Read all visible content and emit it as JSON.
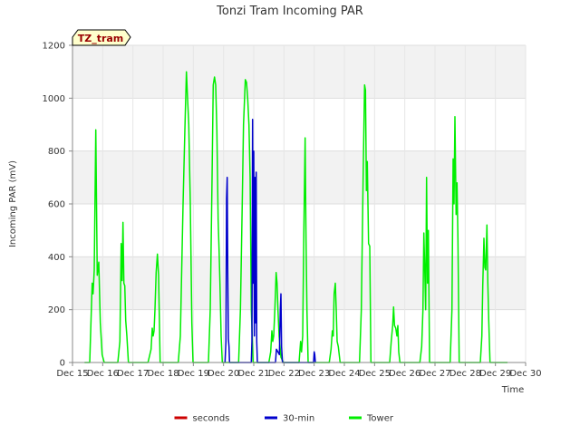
{
  "chart_data": {
    "type": "line",
    "title": "Tonzi Tram Incoming PAR",
    "xlabel": "Time",
    "ylabel": "Incoming PAR (mV)",
    "badge": {
      "text": "TZ_tram",
      "bg": "#ffffcc",
      "fg": "#990000"
    },
    "ylim": [
      0,
      1200
    ],
    "yticks": [
      0,
      200,
      400,
      600,
      800,
      1000,
      1200
    ],
    "xlim": [
      15,
      30
    ],
    "xticks": [
      15,
      16,
      17,
      18,
      19,
      20,
      21,
      22,
      23,
      24,
      25,
      26,
      27,
      28,
      29,
      30
    ],
    "xtick_labels": [
      "Dec 15",
      "Dec 16",
      "Dec 17",
      "Dec 18",
      "Dec 19",
      "Dec 20",
      "Dec 21",
      "Dec 22",
      "Dec 23",
      "Dec 24",
      "Dec 25",
      "Dec 26",
      "Dec 27",
      "Dec 28",
      "Dec 29",
      "Dec 30"
    ],
    "grid": true,
    "legend_position": "bottom",
    "series": [
      {
        "name": "seconds",
        "color": "#cc0000",
        "points": []
      },
      {
        "name": "30-min",
        "color": "#0000cc",
        "points": [
          [
            20.05,
            0
          ],
          [
            20.08,
            80
          ],
          [
            20.1,
            620
          ],
          [
            20.12,
            700
          ],
          [
            20.14,
            350
          ],
          [
            20.16,
            90
          ],
          [
            20.18,
            60
          ],
          [
            20.2,
            0
          ],
          [
            20.92,
            0
          ],
          [
            20.94,
            80
          ],
          [
            20.96,
            920
          ],
          [
            20.98,
            300
          ],
          [
            21.0,
            800
          ],
          [
            21.02,
            100
          ],
          [
            21.04,
            700
          ],
          [
            21.06,
            150
          ],
          [
            21.08,
            720
          ],
          [
            21.1,
            80
          ],
          [
            21.12,
            0
          ],
          [
            21.72,
            0
          ],
          [
            21.75,
            50
          ],
          [
            21.8,
            40
          ],
          [
            21.85,
            30
          ],
          [
            21.88,
            200
          ],
          [
            21.9,
            260
          ],
          [
            21.92,
            60
          ],
          [
            21.95,
            0
          ],
          [
            22.98,
            0
          ],
          [
            23.0,
            40
          ],
          [
            23.02,
            30
          ],
          [
            23.04,
            0
          ]
        ]
      },
      {
        "name": "Tower",
        "color": "#00ee00",
        "points": [
          [
            15.4,
            0
          ],
          [
            15.57,
            0
          ],
          [
            15.65,
            300
          ],
          [
            15.68,
            260
          ],
          [
            15.72,
            350
          ],
          [
            15.77,
            880
          ],
          [
            15.82,
            330
          ],
          [
            15.87,
            380
          ],
          [
            15.92,
            150
          ],
          [
            15.98,
            30
          ],
          [
            16.05,
            0
          ],
          [
            16.1,
            0
          ],
          [
            16.5,
            0
          ],
          [
            16.57,
            80
          ],
          [
            16.61,
            450
          ],
          [
            16.64,
            310
          ],
          [
            16.67,
            530
          ],
          [
            16.7,
            300
          ],
          [
            16.73,
            290
          ],
          [
            16.76,
            160
          ],
          [
            16.8,
            100
          ],
          [
            16.85,
            0
          ],
          [
            16.9,
            0
          ],
          [
            17.5,
            0
          ],
          [
            17.6,
            50
          ],
          [
            17.64,
            130
          ],
          [
            17.67,
            100
          ],
          [
            17.7,
            120
          ],
          [
            17.73,
            200
          ],
          [
            17.77,
            340
          ],
          [
            17.81,
            410
          ],
          [
            17.85,
            330
          ],
          [
            17.9,
            0
          ],
          [
            17.95,
            0
          ],
          [
            18.5,
            0
          ],
          [
            18.57,
            100
          ],
          [
            18.66,
            600
          ],
          [
            18.72,
            880
          ],
          [
            18.77,
            1100
          ],
          [
            18.8,
            1020
          ],
          [
            18.85,
            900
          ],
          [
            18.9,
            600
          ],
          [
            18.95,
            150
          ],
          [
            18.99,
            0
          ],
          [
            19.1,
            0
          ],
          [
            19.5,
            0
          ],
          [
            19.56,
            200
          ],
          [
            19.62,
            700
          ],
          [
            19.66,
            1050
          ],
          [
            19.7,
            1080
          ],
          [
            19.74,
            1050
          ],
          [
            19.78,
            880
          ],
          [
            19.82,
            540
          ],
          [
            19.85,
            430
          ],
          [
            19.88,
            300
          ],
          [
            19.92,
            100
          ],
          [
            19.96,
            0
          ],
          [
            20.15,
            0
          ],
          [
            20.5,
            0
          ],
          [
            20.56,
            200
          ],
          [
            20.62,
            600
          ],
          [
            20.66,
            900
          ],
          [
            20.72,
            1070
          ],
          [
            20.76,
            1060
          ],
          [
            20.8,
            1000
          ],
          [
            20.84,
            900
          ],
          [
            20.88,
            700
          ],
          [
            20.92,
            200
          ],
          [
            20.98,
            0
          ],
          [
            21.1,
            0
          ],
          [
            21.5,
            0
          ],
          [
            21.56,
            40
          ],
          [
            21.6,
            120
          ],
          [
            21.63,
            80
          ],
          [
            21.66,
            100
          ],
          [
            21.7,
            200
          ],
          [
            21.74,
            340
          ],
          [
            21.77,
            300
          ],
          [
            21.8,
            200
          ],
          [
            21.84,
            100
          ],
          [
            21.9,
            20
          ],
          [
            21.98,
            0
          ],
          [
            22.1,
            0
          ],
          [
            22.5,
            0
          ],
          [
            22.55,
            80
          ],
          [
            22.58,
            40
          ],
          [
            22.62,
            100
          ],
          [
            22.66,
            500
          ],
          [
            22.7,
            850
          ],
          [
            22.73,
            460
          ],
          [
            22.76,
            200
          ],
          [
            22.8,
            0
          ],
          [
            22.95,
            0
          ],
          [
            23.5,
            0
          ],
          [
            23.56,
            50
          ],
          [
            23.6,
            120
          ],
          [
            23.63,
            100
          ],
          [
            23.66,
            260
          ],
          [
            23.7,
            300
          ],
          [
            23.73,
            200
          ],
          [
            23.76,
            80
          ],
          [
            23.8,
            60
          ],
          [
            23.86,
            0
          ],
          [
            24.0,
            0
          ],
          [
            24.5,
            0
          ],
          [
            24.56,
            200
          ],
          [
            24.62,
            700
          ],
          [
            24.67,
            1050
          ],
          [
            24.7,
            1030
          ],
          [
            24.73,
            650
          ],
          [
            24.76,
            760
          ],
          [
            24.8,
            450
          ],
          [
            24.84,
            440
          ],
          [
            24.88,
            0
          ],
          [
            25.0,
            0
          ],
          [
            25.5,
            0
          ],
          [
            25.55,
            80
          ],
          [
            25.6,
            140
          ],
          [
            25.63,
            210
          ],
          [
            25.66,
            140
          ],
          [
            25.7,
            130
          ],
          [
            25.74,
            100
          ],
          [
            25.77,
            140
          ],
          [
            25.8,
            40
          ],
          [
            25.84,
            0
          ],
          [
            26.0,
            0
          ],
          [
            26.5,
            0
          ],
          [
            26.56,
            60
          ],
          [
            26.6,
            200
          ],
          [
            26.63,
            490
          ],
          [
            26.66,
            350
          ],
          [
            26.69,
            200
          ],
          [
            26.72,
            700
          ],
          [
            26.75,
            300
          ],
          [
            26.78,
            500
          ],
          [
            26.82,
            0
          ],
          [
            26.95,
            0
          ],
          [
            27.5,
            0
          ],
          [
            27.56,
            200
          ],
          [
            27.6,
            770
          ],
          [
            27.63,
            600
          ],
          [
            27.66,
            930
          ],
          [
            27.7,
            560
          ],
          [
            27.73,
            680
          ],
          [
            27.76,
            470
          ],
          [
            27.8,
            0
          ],
          [
            27.95,
            0
          ],
          [
            28.5,
            0
          ],
          [
            28.55,
            100
          ],
          [
            28.58,
            290
          ],
          [
            28.62,
            470
          ],
          [
            28.65,
            360
          ],
          [
            28.68,
            350
          ],
          [
            28.72,
            520
          ],
          [
            28.75,
            300
          ],
          [
            28.78,
            160
          ],
          [
            28.82,
            0
          ],
          [
            29.0,
            0
          ],
          [
            29.4,
            0
          ]
        ]
      }
    ]
  }
}
